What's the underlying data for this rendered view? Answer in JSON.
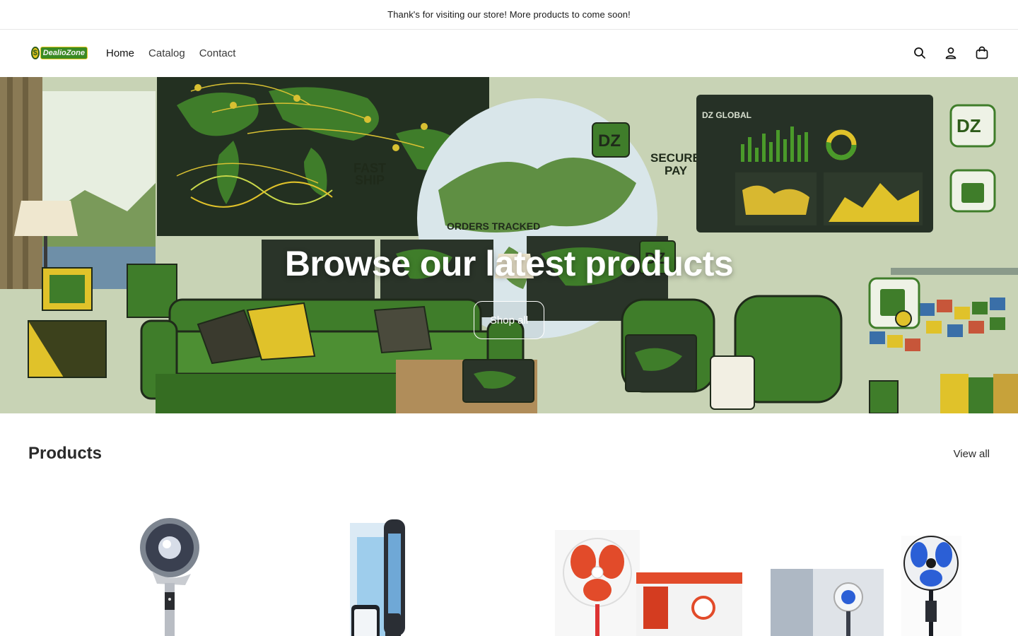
{
  "announcement": {
    "text": "Thank's for visiting our store! More products to come soon!"
  },
  "header": {
    "logo": {
      "coin_symbol": "$",
      "text": "DealioZone"
    },
    "nav": [
      {
        "label": "Home"
      },
      {
        "label": "Catalog"
      },
      {
        "label": "Contact"
      }
    ],
    "icons": [
      "search-icon",
      "account-icon",
      "cart-icon"
    ]
  },
  "hero": {
    "title": "Browse our latest products",
    "button_label": "Shop all",
    "scene_labels": {
      "fast_ship_1": "FAST",
      "fast_ship_2": "SHIP",
      "secure_pay_1": "SECURE",
      "secure_pay_2": "PAY",
      "orders_tracked": "ORDERS TRACKED",
      "dz_global": "DZ GLOBAL",
      "dz": "DZ"
    }
  },
  "products": {
    "title": "Products",
    "view_all": "View all",
    "items": [
      {
        "image": "pedestal-air-circulator-fan"
      },
      {
        "image": "smart-tower-fan-with-remote"
      },
      {
        "image": "red-standing-fan-with-box"
      },
      {
        "image": "blue-standing-fan-with-box"
      }
    ]
  },
  "colors": {
    "accent_green": "#3f7d2a",
    "dark_green": "#2e5b1a",
    "accent_yellow": "#e0c22a"
  }
}
